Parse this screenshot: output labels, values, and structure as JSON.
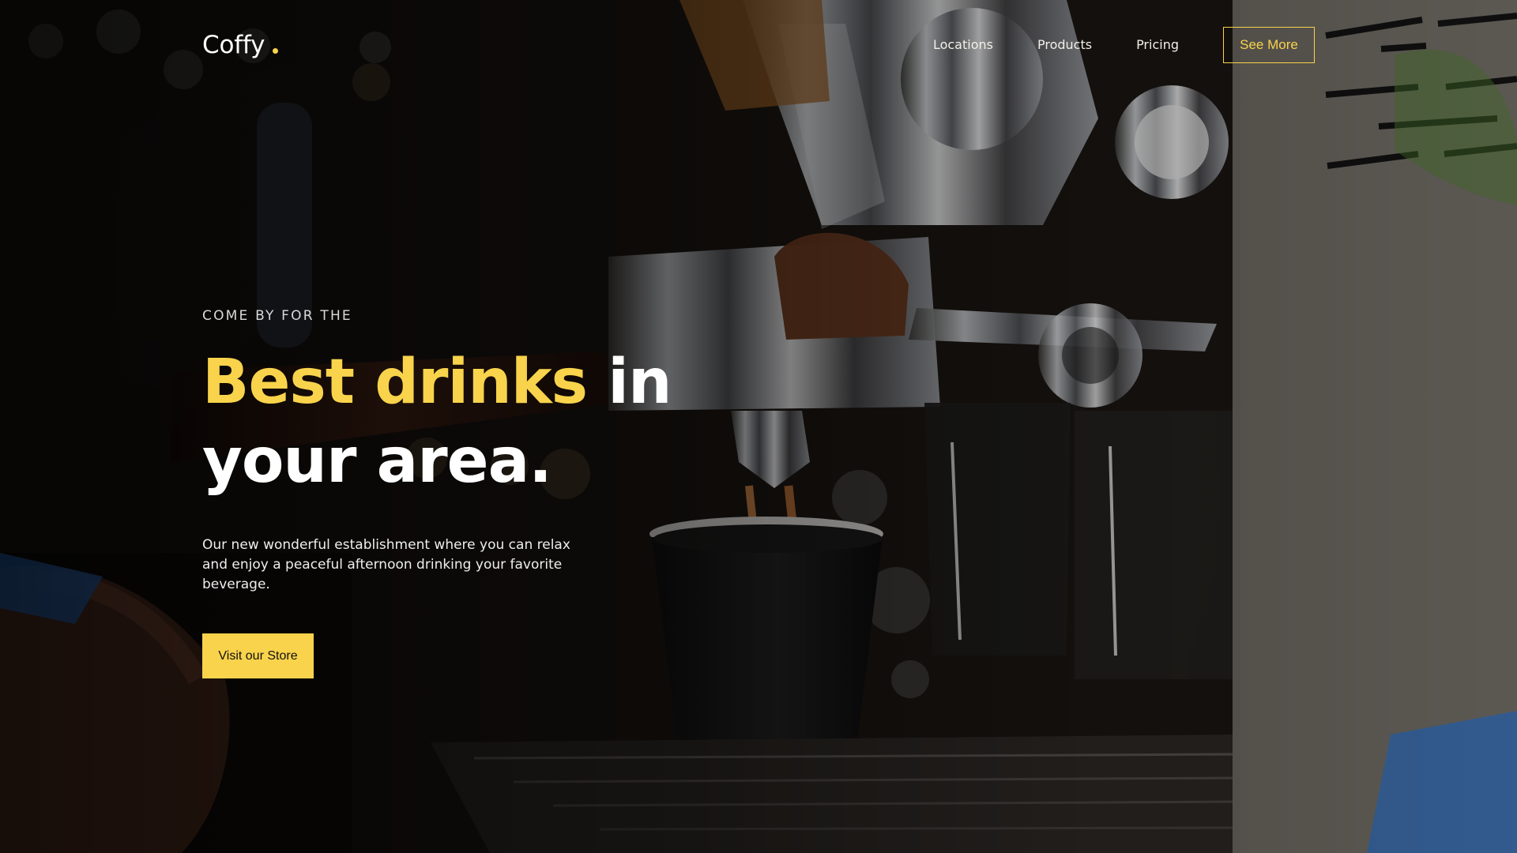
{
  "brand": {
    "name": "Coffy"
  },
  "nav": {
    "items": [
      {
        "label": "Locations"
      },
      {
        "label": "Products"
      },
      {
        "label": "Pricing"
      }
    ],
    "cta": "See More"
  },
  "hero": {
    "eyebrow": "COME BY FOR THE",
    "headline_highlight": "Best drinks",
    "headline_rest": " in your area.",
    "description": "Our new wonderful establishment where you can relax and enjoy a peaceful afternoon drinking your favorite beverage.",
    "button": "Visit our Store",
    "background_icon": "espresso-machine-photo-icon"
  },
  "colors": {
    "accent": "#F8D34B",
    "text": "#FFFFFF",
    "overlay": "#000000"
  }
}
